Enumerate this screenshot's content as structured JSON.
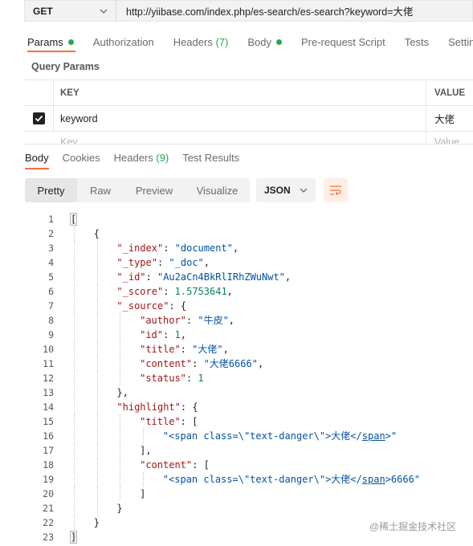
{
  "request": {
    "method": "GET",
    "url": "http://yiibase.com/index.php/es-search/es-search?keyword=大佬"
  },
  "request_tabs": [
    {
      "label": "Params",
      "active": true,
      "dot": true
    },
    {
      "label": "Authorization",
      "active": false
    },
    {
      "label": "Headers (7)",
      "active": false,
      "count_label": "(7)",
      "base": "Headers "
    },
    {
      "label": "Body",
      "active": false,
      "dot": true
    },
    {
      "label": "Pre-request Script",
      "active": false
    },
    {
      "label": "Tests",
      "active": false
    },
    {
      "label": "Settin",
      "active": false
    }
  ],
  "query_params": {
    "title": "Query Params",
    "columns": {
      "key": "KEY",
      "value": "VALUE"
    },
    "rows": [
      {
        "checked": true,
        "key": "keyword",
        "value": "大佬"
      }
    ],
    "placeholder": {
      "key": "Key",
      "value": "Value"
    }
  },
  "response_tabs": [
    {
      "label": "Body",
      "active": true
    },
    {
      "label": "Cookies",
      "active": false
    },
    {
      "label": "Headers",
      "count": "(9)",
      "active": false
    },
    {
      "label": "Test Results",
      "active": false
    }
  ],
  "view_modes": [
    {
      "label": "Pretty",
      "active": true
    },
    {
      "label": "Raw",
      "active": false
    },
    {
      "label": "Preview",
      "active": false
    },
    {
      "label": "Visualize",
      "active": false
    }
  ],
  "format_select": "JSON",
  "code_lines": [
    {
      "n": "1",
      "indent": 0,
      "tokens": [
        [
          "bhl",
          "["
        ]
      ]
    },
    {
      "n": "2",
      "indent": 1,
      "tokens": [
        [
          "p",
          "{"
        ]
      ]
    },
    {
      "n": "3",
      "indent": 2,
      "tokens": [
        [
          "k",
          "\"_index\""
        ],
        [
          "p",
          ": "
        ],
        [
          "s",
          "\"document\""
        ],
        [
          "p",
          ","
        ]
      ]
    },
    {
      "n": "4",
      "indent": 2,
      "tokens": [
        [
          "k",
          "\"_type\""
        ],
        [
          "p",
          ": "
        ],
        [
          "s",
          "\"_doc\""
        ],
        [
          "p",
          ","
        ]
      ]
    },
    {
      "n": "5",
      "indent": 2,
      "tokens": [
        [
          "k",
          "\"_id\""
        ],
        [
          "p",
          ": "
        ],
        [
          "s",
          "\"Au2aCn4BkRlIRhZWuNwt\""
        ],
        [
          "p",
          ","
        ]
      ]
    },
    {
      "n": "6",
      "indent": 2,
      "tokens": [
        [
          "k",
          "\"_score\""
        ],
        [
          "p",
          ": "
        ],
        [
          "n",
          "1.5753641"
        ],
        [
          "p",
          ","
        ]
      ]
    },
    {
      "n": "7",
      "indent": 2,
      "tokens": [
        [
          "k",
          "\"_source\""
        ],
        [
          "p",
          ": {"
        ]
      ]
    },
    {
      "n": "8",
      "indent": 3,
      "tokens": [
        [
          "k",
          "\"author\""
        ],
        [
          "p",
          ": "
        ],
        [
          "s",
          "\"牛皮\""
        ],
        [
          "p",
          ","
        ]
      ]
    },
    {
      "n": "9",
      "indent": 3,
      "tokens": [
        [
          "k",
          "\"id\""
        ],
        [
          "p",
          ": "
        ],
        [
          "n",
          "1"
        ],
        [
          "p",
          ","
        ]
      ]
    },
    {
      "n": "10",
      "indent": 3,
      "tokens": [
        [
          "k",
          "\"title\""
        ],
        [
          "p",
          ": "
        ],
        [
          "s",
          "\"大佬\""
        ],
        [
          "p",
          ","
        ]
      ]
    },
    {
      "n": "11",
      "indent": 3,
      "tokens": [
        [
          "k",
          "\"content\""
        ],
        [
          "p",
          ": "
        ],
        [
          "s",
          "\"大佬6666\""
        ],
        [
          "p",
          ","
        ]
      ]
    },
    {
      "n": "12",
      "indent": 3,
      "tokens": [
        [
          "k",
          "\"status\""
        ],
        [
          "p",
          ": "
        ],
        [
          "n",
          "1"
        ]
      ]
    },
    {
      "n": "13",
      "indent": 2,
      "tokens": [
        [
          "p",
          "},"
        ]
      ]
    },
    {
      "n": "14",
      "indent": 2,
      "tokens": [
        [
          "k",
          "\"highlight\""
        ],
        [
          "p",
          ": {"
        ]
      ]
    },
    {
      "n": "15",
      "indent": 3,
      "tokens": [
        [
          "k",
          "\"title\""
        ],
        [
          "p",
          ": ["
        ]
      ]
    },
    {
      "n": "16",
      "indent": 4,
      "tokens": [
        [
          "s",
          "\"<span class=\\\"text-danger\\\">大佬</"
        ],
        [
          "su",
          "span"
        ],
        [
          "s",
          ">\""
        ]
      ]
    },
    {
      "n": "17",
      "indent": 3,
      "tokens": [
        [
          "p",
          "],"
        ]
      ]
    },
    {
      "n": "18",
      "indent": 3,
      "tokens": [
        [
          "k",
          "\"content\""
        ],
        [
          "p",
          ": ["
        ]
      ]
    },
    {
      "n": "19",
      "indent": 4,
      "tokens": [
        [
          "s",
          "\"<span class=\\\"text-danger\\\">大佬</"
        ],
        [
          "su",
          "span"
        ],
        [
          "s",
          ">6666\""
        ]
      ]
    },
    {
      "n": "20",
      "indent": 3,
      "tokens": [
        [
          "p",
          "]"
        ]
      ]
    },
    {
      "n": "21",
      "indent": 2,
      "tokens": [
        [
          "p",
          "}"
        ]
      ]
    },
    {
      "n": "22",
      "indent": 1,
      "tokens": [
        [
          "p",
          "}"
        ]
      ]
    },
    {
      "n": "23",
      "indent": 0,
      "tokens": [
        [
          "bhl",
          "]"
        ]
      ]
    }
  ],
  "watermark": "@稀土掘金技术社区",
  "colors": {
    "accent": "#ff6c37",
    "status_green": "#2ea44f",
    "json_key": "#a31515",
    "json_string": "#0451a5",
    "json_number": "#098658"
  },
  "icons": {
    "method_dropdown": "chevron-down-icon",
    "format_dropdown": "chevron-down-icon",
    "wrap": "wrap-lines-icon",
    "checkbox": "checkbox-checked-icon"
  }
}
